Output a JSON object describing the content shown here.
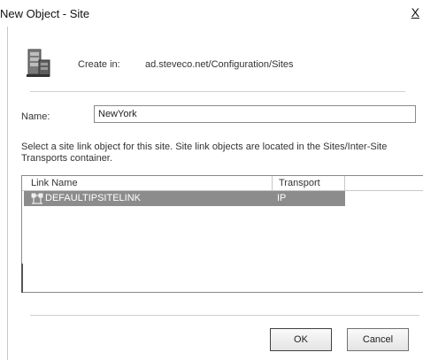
{
  "window": {
    "title": "New Object - Site",
    "close_glyph": "X"
  },
  "header": {
    "create_in_label": "Create in:",
    "create_in_path": "ad.steveco.net/Configuration/Sites",
    "icon": "site-container-icon"
  },
  "form": {
    "name_label": "Name:",
    "name_value": "NewYork"
  },
  "description": "Select a site link object for this site. Site link objects are located in the Sites/Inter-Site Transports container.",
  "site_links": {
    "columns": [
      "Link Name",
      "Transport"
    ],
    "rows": [
      {
        "link_name": "DEFAULTIPSITELINK",
        "transport": "IP",
        "selected": true,
        "icon": "site-link-icon"
      }
    ]
  },
  "buttons": {
    "ok": "OK",
    "cancel": "Cancel"
  },
  "colors": {
    "selection": "#8c8c8c",
    "border": "#8a8a8a"
  }
}
